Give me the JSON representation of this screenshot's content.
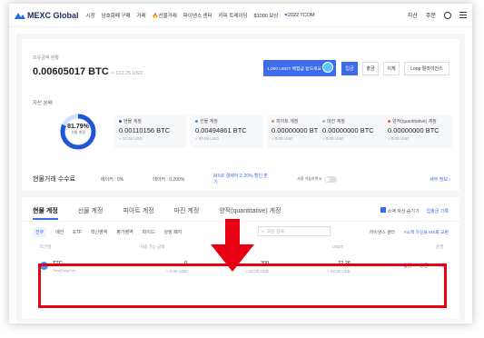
{
  "nav": {
    "logo": "MEXC Global",
    "items": [
      "시장",
      "암호화폐 구매",
      "거래",
      "선물거래",
      "파이낸스 센터",
      "카피 트레이딩",
      "$1000 보상",
      "2022 TCOM"
    ],
    "right_items": [
      "자산",
      "주문"
    ]
  },
  "balance": {
    "label": "보유금액 현황",
    "value": "0.00605017 BTC",
    "usd": "≈ 122.25 USD",
    "promo_text": "1,000 USDT 체험금 받으세요",
    "buttons": [
      "입금",
      "출금",
      "이체",
      "Loop 릴라이언스"
    ]
  },
  "distribution": {
    "label": "자산 분배",
    "donut_pct": "81.79%",
    "donut_sub": "선물 계정",
    "donut_share": 0.8179,
    "stats": [
      {
        "name": "현물 계정",
        "value": "0.00110156 BTC",
        "usd": "≈ 22.25 USD",
        "color": "#1f55d6"
      },
      {
        "name": "선물 계정",
        "value": "0.00494861 BTC",
        "usd": "≈ 99.99 USD",
        "color": "#3e8cf0"
      },
      {
        "name": "피아트 계정",
        "value": "0.00000000 BTC",
        "usd": "≈ 0.00 USD",
        "color": "#f08a3e"
      },
      {
        "name": "마진 계정",
        "value": "0.00000000 BTC",
        "usd": "≈ 0.00 USD",
        "color": "#7ac0ff"
      },
      {
        "name": "양적(quantitative) 계정",
        "value": "0.00000000 BTC",
        "usd": "≈ 0.00 USD",
        "color": "#f05a3e"
      }
    ]
  },
  "fees": {
    "title": "현물거래 수수료",
    "maker": "메이커 : 0%",
    "taker": "테이커 : 0.200%",
    "mx_text": "MX로 결제하고 20% 할인 받기",
    "toggle_label": "사용 가능하면 B",
    "link": "세부 정보 ›"
  },
  "accounts": {
    "tabs": [
      "현물 계정",
      "선물 계정",
      "피아트 계정",
      "마진 계정",
      "양적(quantitative) 계정"
    ],
    "hide_small": "소액 자산 숨기기",
    "history": "입출금 기록",
    "subtabs": [
      "전부",
      "메인",
      "ETF",
      "혁신영역",
      "평가영역",
      "파이드",
      "상장 폐지"
    ],
    "search_placeholder": "코인 검색",
    "sub_right": [
      "파이낸스 센터",
      "#소액 자산을 MX로 교환"
    ],
    "headers": [
      "토큰명",
      "사용 가능 금액",
      "",
      "USDT",
      "운영"
    ],
    "row": {
      "coin": "TTC",
      "coin_full": "TongTongCoin",
      "available": "0",
      "available_usd": "≈ 0.00 USD",
      "total": "300",
      "total_usd": "≈ 22.20 USD",
      "usdt": "22.26",
      "usdt_usd": "≈ 22.20 USD",
      "actions": [
        "입금",
        "출금",
        "거래"
      ]
    }
  }
}
